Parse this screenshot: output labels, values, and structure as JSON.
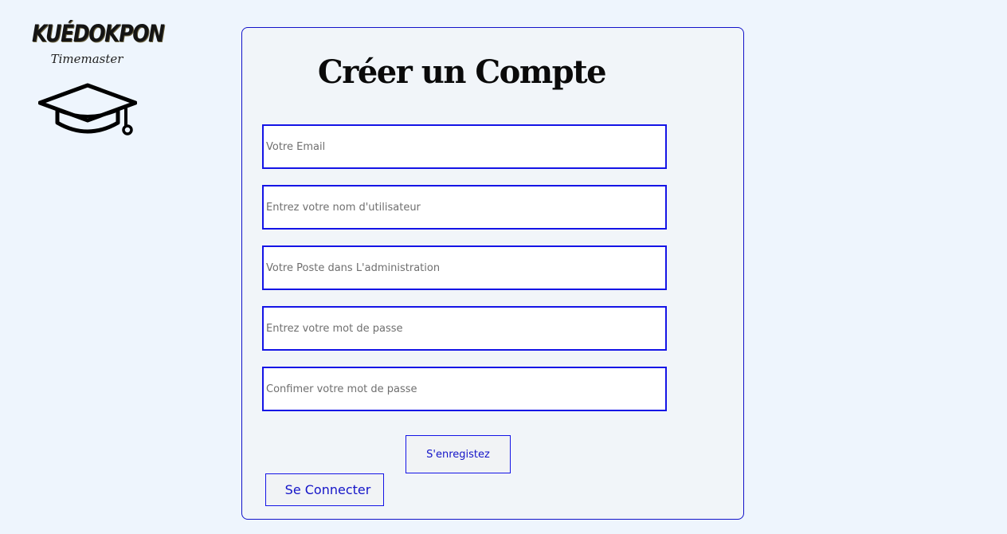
{
  "logo": {
    "brand": "KUÉDOKPON",
    "subtitle": "Timemaster",
    "icon": "graduation-cap-icon"
  },
  "form": {
    "title": "Créer un Compte",
    "fields": [
      {
        "name": "email",
        "value": "",
        "placeholder": "Votre Email"
      },
      {
        "name": "username",
        "value": "",
        "placeholder": "Entrez votre nom d'utilisateur"
      },
      {
        "name": "position",
        "value": "",
        "placeholder": "Votre Poste dans L'administration"
      },
      {
        "name": "password",
        "value": "",
        "placeholder": "Entrez votre mot de passe"
      },
      {
        "name": "password_confirm",
        "value": "",
        "placeholder": "Confimer votre mot de passe"
      }
    ],
    "register_label": "S'enregistez",
    "login_label": "Se Connecter"
  },
  "colors": {
    "accent": "#1414e6",
    "background": "#eef5fd",
    "card": "#f1f5f9"
  }
}
